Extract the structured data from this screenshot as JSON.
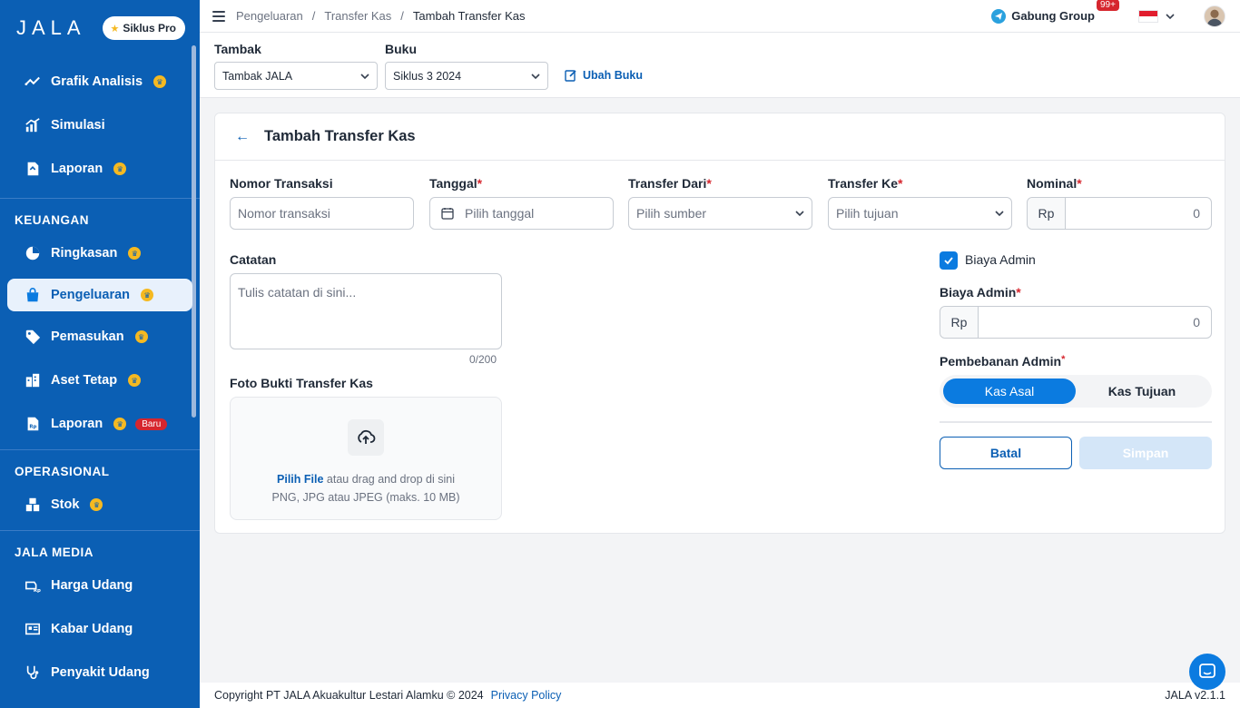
{
  "sidebar": {
    "logo": "JALA",
    "pro_badge": "Siklus Pro",
    "top_items": [
      {
        "label": "Grafik Analisis",
        "icon": "trend-line-icon",
        "pro": true
      },
      {
        "label": "Simulasi",
        "icon": "bar-chart-icon",
        "pro": false
      },
      {
        "label": "Laporan",
        "icon": "report-icon",
        "pro": true
      }
    ],
    "sections": [
      {
        "title": "KEUANGAN",
        "items": [
          {
            "label": "Ringkasan",
            "icon": "pie-chart-icon",
            "pro": true
          },
          {
            "label": "Pengeluaran",
            "icon": "shopping-bag-icon",
            "pro": true,
            "active": true
          },
          {
            "label": "Pemasukan",
            "icon": "tag-icon",
            "pro": true
          },
          {
            "label": "Aset Tetap",
            "icon": "building-icon",
            "pro": true
          },
          {
            "label": "Laporan",
            "icon": "rupiah-report-icon",
            "pro": true,
            "badge": "Baru"
          }
        ]
      },
      {
        "title": "OPERASIONAL",
        "items": [
          {
            "label": "Stok",
            "icon": "boxes-icon",
            "pro": true
          }
        ]
      },
      {
        "title": "JALA MEDIA",
        "items": [
          {
            "label": "Harga Udang",
            "icon": "shrimp-price-icon",
            "pro": false
          },
          {
            "label": "Kabar Udang",
            "icon": "news-icon",
            "pro": false
          },
          {
            "label": "Penyakit Udang",
            "icon": "stethoscope-icon",
            "pro": false
          }
        ]
      }
    ]
  },
  "header": {
    "breadcrumb": [
      "Pengeluaran",
      "Transfer Kas",
      "Tambah Transfer Kas"
    ],
    "group_label": "Gabung Group",
    "notif_count": "99+"
  },
  "selectors": {
    "tambak_label": "Tambak",
    "tambak_value": "Tambak JALA",
    "buku_label": "Buku",
    "buku_value": "Siklus 3 2024",
    "ubah_buku": "Ubah Buku"
  },
  "form": {
    "title": "Tambah Transfer Kas",
    "nomor_label": "Nomor Transaksi",
    "nomor_placeholder": "Nomor transaksi",
    "tanggal_label": "Tanggal",
    "tanggal_placeholder": "Pilih tanggal",
    "dari_label": "Transfer Dari",
    "dari_placeholder": "Pilih sumber",
    "ke_label": "Transfer Ke",
    "ke_placeholder": "Pilih tujuan",
    "nominal_label": "Nominal",
    "currency": "Rp",
    "nominal_value": "0",
    "catatan_label": "Catatan",
    "catatan_placeholder": "Tulis catatan di sini...",
    "catatan_counter": "0/200",
    "foto_label": "Foto Bukti Transfer Kas",
    "upload_link": "Pilih File",
    "upload_text": "atau drag and drop di sini",
    "upload_hint": "PNG, JPG atau JPEG (maks. 10 MB)",
    "biaya_admin_check": "Biaya Admin",
    "biaya_admin_label": "Biaya Admin",
    "biaya_admin_value": "0",
    "pembebanan_label": "Pembebanan Admin",
    "pembebanan_options": [
      "Kas Asal",
      "Kas Tujuan"
    ],
    "batal": "Batal",
    "simpan": "Simpan"
  },
  "footer": {
    "copyright": "Copyright PT JALA Akuakultur Lestari Alamku © 2024",
    "privacy": "Privacy Policy",
    "version": "JALA v2.1.1"
  },
  "colors": {
    "primary": "#0b5fb4",
    "accent": "#0b7be0",
    "required": "#d6262e",
    "pro": "#f5b921"
  }
}
